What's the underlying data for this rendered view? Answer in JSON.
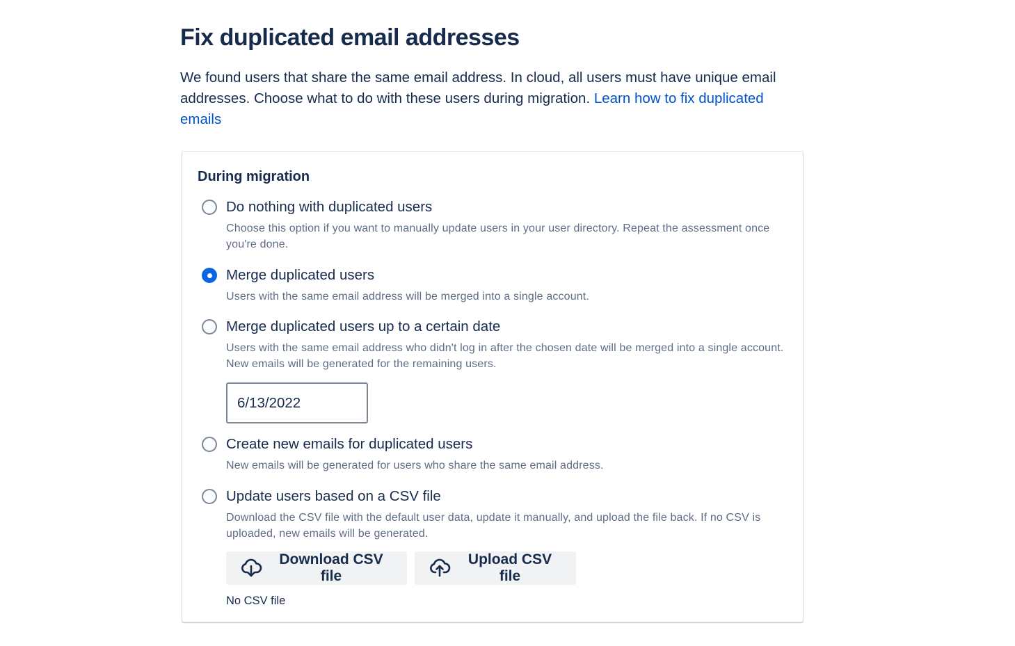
{
  "page": {
    "title": "Fix duplicated email addresses",
    "intro_text": "We found users that share the same email address. In cloud, all users must have unique email addresses. Choose what to do with these users during migration. ",
    "learn_link": "Learn how to fix duplicated emails"
  },
  "card": {
    "heading": "During migration",
    "options": [
      {
        "label": "Do nothing with duplicated users",
        "description": "Choose this option if you want to manually update users in your user directory. Repeat the assessment once you're done.",
        "selected": false
      },
      {
        "label": "Merge duplicated users",
        "description": "Users with the same email address will be merged into a single account.",
        "selected": true
      },
      {
        "label": "Merge duplicated users up to a certain date",
        "description": "Users with the same email address who didn't log in after the chosen date will be merged into a single account. New emails will be generated for the remaining users.",
        "selected": false
      },
      {
        "label": "Create new emails for duplicated users",
        "description": "New emails will be generated for users who share the same email address.",
        "selected": false
      },
      {
        "label": "Update users based on a CSV file",
        "description": "Download the CSV file with the default user data, update it manually, and upload the file back. If no CSV is uploaded, new emails will be generated.",
        "selected": false
      }
    ],
    "date_value": "6/13/2022",
    "download_button": "Download CSV file",
    "upload_button": "Upload CSV file",
    "csv_status": "No CSV file"
  },
  "colors": {
    "heading": "#172b4d",
    "link": "#0052cc",
    "secondary_text": "#5e6c84",
    "radio_selected": "#0c66e4",
    "button_bg": "#f1f2f4"
  },
  "icons": {
    "download": "cloud-download-icon",
    "upload": "cloud-upload-icon"
  }
}
